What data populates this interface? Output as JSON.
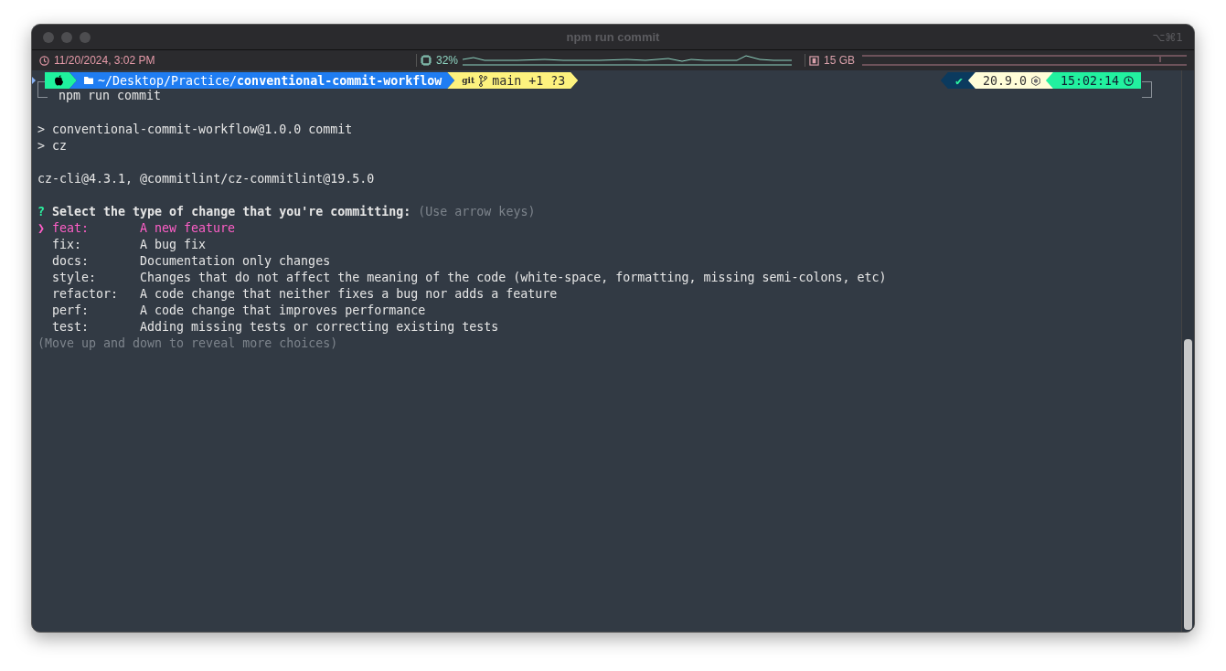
{
  "window": {
    "title": "npm run commit",
    "shortcut": "⌥⌘1"
  },
  "status_bar": {
    "datetime": "11/20/2024, 3:02 PM",
    "cpu": "32%",
    "memory": "15 GB"
  },
  "prompt": {
    "path": "~/Desktop/Practice/**conventional-commit-workflow**",
    "vcs": "git",
    "branch": "main +1 ?3",
    "status": "✔",
    "node_version": "20.9.0",
    "time": "15:02:14",
    "command": "npm run commit"
  },
  "output": [
    [
      "> conventional-commit-workflow@1.0.0 commit",
      "> cz"
    ],
    [
      "cz-cli@4.3.1, @commitlint/cz-commitlint@19.5.0"
    ]
  ],
  "question": {
    "mark": "?",
    "text": "Select the type of change that you're committing:",
    "hint": "(Use arrow keys)",
    "pointer": "❯",
    "choices": [
      {
        "name": "feat:",
        "description": "A new feature",
        "selected": true
      },
      {
        "name": "fix:",
        "description": "A bug fix",
        "selected": false
      },
      {
        "name": "docs:",
        "description": "Documentation only changes",
        "selected": false
      },
      {
        "name": "style:",
        "description": "Changes that do not affect the meaning of the code (white-space, formatting, missing semi-colons, etc)",
        "selected": false
      },
      {
        "name": "refactor:",
        "description": "A code change that neither fixes a bug nor adds a feature",
        "selected": false
      },
      {
        "name": "perf:",
        "description": "A code change that improves performance",
        "selected": false
      },
      {
        "name": "test:",
        "description": "Adding missing tests or correcting existing tests",
        "selected": false
      }
    ],
    "footer": "(Move up and down to reveal more choices)"
  }
}
